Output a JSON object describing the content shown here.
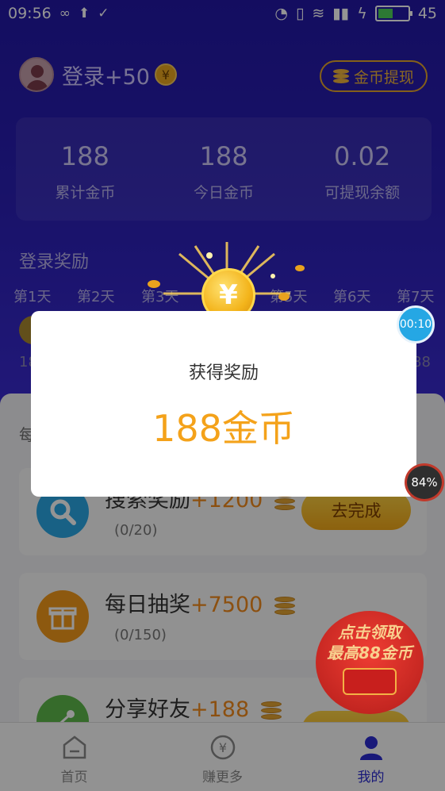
{
  "status_bar": {
    "time": "09:56",
    "battery": "45"
  },
  "header": {
    "login_text": "登录+50",
    "yen_symbol": "¥",
    "withdraw_label": "金币提现"
  },
  "stats": [
    {
      "value": "188",
      "label": "累计金币"
    },
    {
      "value": "188",
      "label": "今日金币"
    },
    {
      "value": "0.02",
      "label": "可提现余额"
    }
  ],
  "login_reward": {
    "title": "登录奖励",
    "days": [
      "第1天",
      "第2天",
      "第3天",
      "第5天",
      "第6天",
      "第7天"
    ]
  },
  "partial_values": {
    "left": "18",
    "right": "88"
  },
  "lower_peek": "每",
  "tasks": [
    {
      "title": "搜索奖励",
      "plus": "+1200",
      "progress": "(0/20)",
      "button": "去完成",
      "icon": "search-icon",
      "icon_color": "#2aa7e6"
    },
    {
      "title": "每日抽奖",
      "plus": "+7500",
      "progress": "(0/150)",
      "icon": "gift-icon",
      "icon_color": "#f39a1b"
    },
    {
      "title": "分享好友",
      "plus": "+188",
      "button": "去完成",
      "icon": "share-icon",
      "icon_color": "#5db84a"
    }
  ],
  "modal": {
    "title": "获得奖励",
    "amount": "188金币",
    "coin_symbol": "¥"
  },
  "timer": "00:10",
  "percent_badge": "84%",
  "promo": {
    "line1": "点击领取",
    "line2": "最高88金币"
  },
  "tabbar": [
    {
      "label": "首页",
      "icon": "home-icon"
    },
    {
      "label": "赚更多",
      "icon": "yen-circle-icon"
    },
    {
      "label": "我的",
      "icon": "person-icon",
      "active": true
    }
  ],
  "colors": {
    "accent": "#f4a21a",
    "header_bg": "#2318a6",
    "active_tab": "#2b2bd0"
  }
}
